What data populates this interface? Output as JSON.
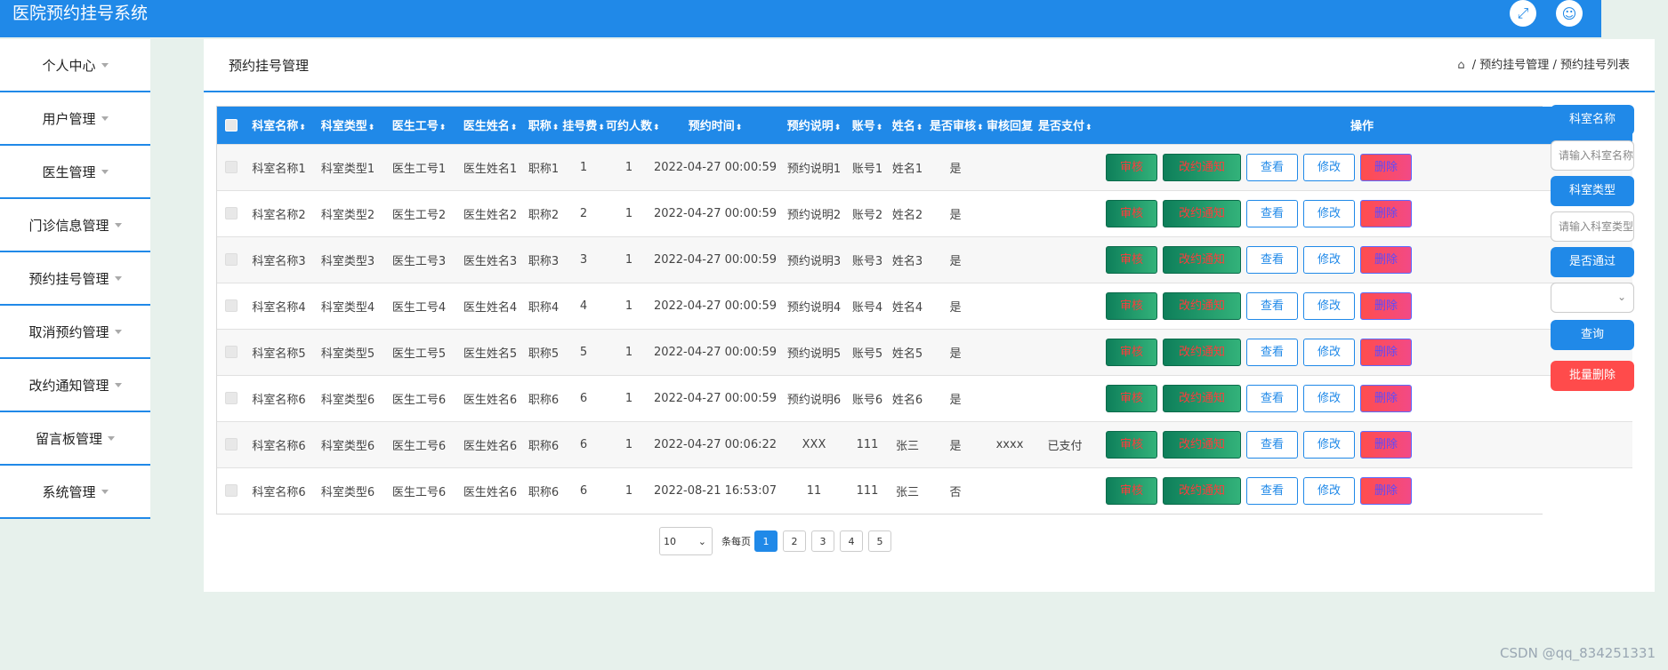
{
  "app": {
    "title": "医院预约挂号系统"
  },
  "topbar": {
    "fullscreen_icon": "expand-icon",
    "user_icon": "user-icon"
  },
  "sidebar": {
    "items": [
      {
        "label": "个人中心"
      },
      {
        "label": "用户管理"
      },
      {
        "label": "医生管理"
      },
      {
        "label": "门诊信息管理"
      },
      {
        "label": "预约挂号管理"
      },
      {
        "label": "取消预约管理"
      },
      {
        "label": "改约通知管理"
      },
      {
        "label": "留言板管理"
      },
      {
        "label": "系统管理"
      }
    ]
  },
  "panel": {
    "title": "预约挂号管理",
    "breadcrumb": {
      "sep": "/",
      "level1": "预约挂号管理",
      "level2": "预约挂号列表"
    }
  },
  "table": {
    "headers": [
      "科室名称",
      "科室类型",
      "医生工号",
      "医生姓名",
      "职称",
      "挂号费",
      "可约人数",
      "预约时间",
      "预约说明",
      "账号",
      "姓名",
      "是否审核",
      "审核回复",
      "是否支付",
      "操作"
    ],
    "sortable": [
      true,
      true,
      true,
      true,
      true,
      true,
      true,
      true,
      true,
      true,
      true,
      true,
      false,
      true,
      false
    ],
    "rows": [
      [
        "科室名称1",
        "科室类型1",
        "医生工号1",
        "医生姓名1",
        "职称1",
        "1",
        "1",
        "2022-04-27 00:00:59",
        "预约说明1",
        "账号1",
        "姓名1",
        "是",
        "",
        ""
      ],
      [
        "科室名称2",
        "科室类型2",
        "医生工号2",
        "医生姓名2",
        "职称2",
        "2",
        "1",
        "2022-04-27 00:00:59",
        "预约说明2",
        "账号2",
        "姓名2",
        "是",
        "",
        ""
      ],
      [
        "科室名称3",
        "科室类型3",
        "医生工号3",
        "医生姓名3",
        "职称3",
        "3",
        "1",
        "2022-04-27 00:00:59",
        "预约说明3",
        "账号3",
        "姓名3",
        "是",
        "",
        ""
      ],
      [
        "科室名称4",
        "科室类型4",
        "医生工号4",
        "医生姓名4",
        "职称4",
        "4",
        "1",
        "2022-04-27 00:00:59",
        "预约说明4",
        "账号4",
        "姓名4",
        "是",
        "",
        ""
      ],
      [
        "科室名称5",
        "科室类型5",
        "医生工号5",
        "医生姓名5",
        "职称5",
        "5",
        "1",
        "2022-04-27 00:00:59",
        "预约说明5",
        "账号5",
        "姓名5",
        "是",
        "",
        ""
      ],
      [
        "科室名称6",
        "科室类型6",
        "医生工号6",
        "医生姓名6",
        "职称6",
        "6",
        "1",
        "2022-04-27 00:00:59",
        "预约说明6",
        "账号6",
        "姓名6",
        "是",
        "",
        ""
      ],
      [
        "科室名称6",
        "科室类型6",
        "医生工号6",
        "医生姓名6",
        "职称6",
        "6",
        "1",
        "2022-04-27 00:06:22",
        "XXX",
        "111",
        "张三",
        "是",
        "xxxx",
        "已支付"
      ],
      [
        "科室名称6",
        "科室类型6",
        "医生工号6",
        "医生姓名6",
        "职称6",
        "6",
        "1",
        "2022-08-21 16:53:07",
        "11",
        "111",
        "张三",
        "否",
        "",
        ""
      ]
    ],
    "actions": {
      "audit": "审核",
      "notify": "改约通知",
      "view": "查看",
      "edit": "修改",
      "delete": "删除"
    }
  },
  "pager": {
    "page_size": "10",
    "per_page_label": "条每页",
    "pages": [
      "1",
      "2",
      "3",
      "4",
      "5"
    ],
    "current": "1"
  },
  "filters": {
    "dept_name_label": "科室名称",
    "dept_name_placeholder": "请输入科室名称",
    "dept_type_label": "科室类型",
    "dept_type_placeholder": "请输入科室类型",
    "passed_label": "是否通过",
    "passed_value": "",
    "query_label": "查询",
    "batch_delete_label": "批量删除"
  },
  "watermark": "CSDN @qq_834251331",
  "colors": {
    "primary": "#2089e8",
    "danger": "#ff4b4b",
    "success": "#0e7f5a"
  }
}
